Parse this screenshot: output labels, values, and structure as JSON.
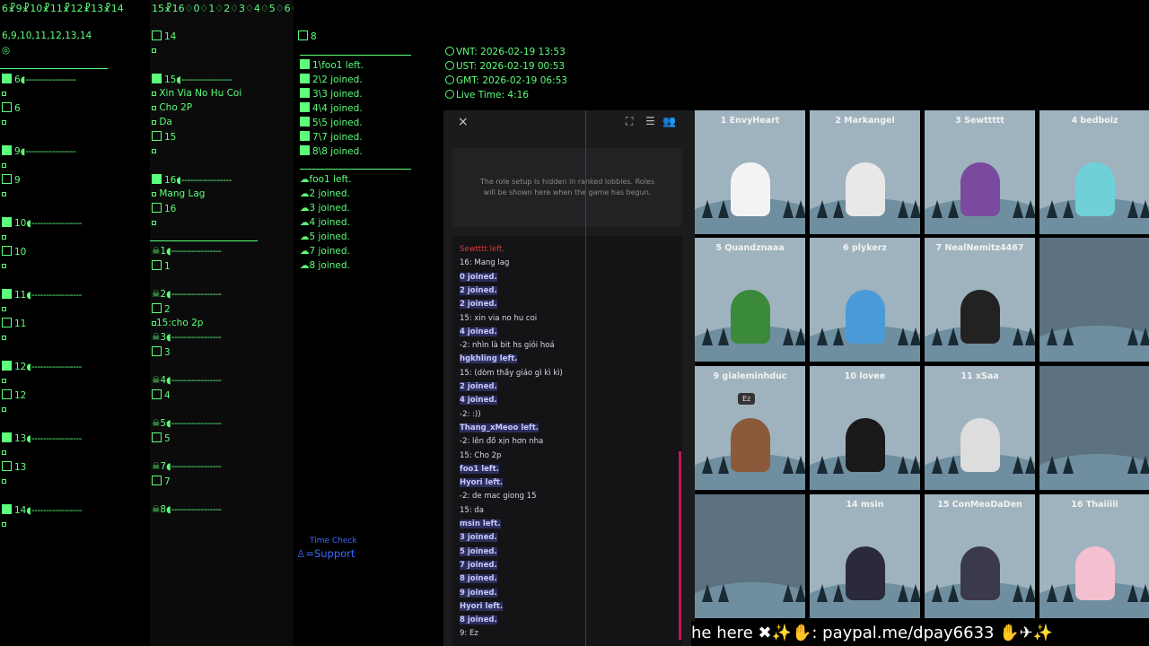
{
  "col1": {
    "header": "6☧9☧10☧11☧12☧13☧14",
    "sub": "6,9,10,11,12,13,14",
    "groups": [
      {
        "num": "6",
        "label": "6"
      },
      {
        "num": "9",
        "label": "9"
      },
      {
        "num": "10",
        "label": "10"
      },
      {
        "num": "11",
        "label": "11"
      },
      {
        "num": "12",
        "label": "12"
      },
      {
        "num": "13",
        "label": "13"
      },
      {
        "num": "14",
        "label": ""
      }
    ]
  },
  "col2": {
    "header": "15☧16♢0♢1♢2♢3♢4♢5♢6♢7",
    "top": "14",
    "g15": {
      "num": "15",
      "lines": [
        "Xin Via No Hu Coi",
        "Cho 2P",
        "Da"
      ],
      "label": "15"
    },
    "g16": {
      "num": "16",
      "lines": [
        "Mang Lag"
      ],
      "label": "16"
    },
    "dead": [
      {
        "num": "1",
        "label": "1",
        "extra": ""
      },
      {
        "num": "2",
        "label": "2",
        "extra": "15:cho 2p"
      },
      {
        "num": "3",
        "label": "3",
        "extra": ""
      },
      {
        "num": "4",
        "label": "4",
        "extra": ""
      },
      {
        "num": "5",
        "label": "5",
        "extra": ""
      },
      {
        "num": "7",
        "label": "7",
        "extra": ""
      },
      {
        "num": "8",
        "label": "",
        "extra": ""
      }
    ]
  },
  "col3": {
    "top": "8",
    "log1": [
      "1\\foo1 left.",
      "2\\2 joined.",
      "3\\3 joined.",
      "4\\4 joined.",
      "5\\5 joined.",
      "7\\7 joined.",
      "8\\8 joined."
    ],
    "log2": [
      "foo1 left.",
      "2 joined.",
      "3 joined.",
      "4 joined.",
      "5 joined.",
      "7 joined.",
      "8 joined."
    ],
    "support": "=Support",
    "support_hidden": "Time Check"
  },
  "clock": [
    "VNT: 2026-02-19 13:53",
    "UST: 2026-02-19 00:53",
    "GMT: 2026-02-19 06:53",
    "Live Time: 4:16"
  ],
  "panel": {
    "close": "×",
    "roles_text": "The role setup is hidden in ranked lobbies. Roles will be shown here when the game has begun.",
    "chat": [
      {
        "t": "Sewtttt left.",
        "k": "red"
      },
      {
        "t": "16: Mang lag",
        "k": "n"
      },
      {
        "t": "0 joined.",
        "k": "b"
      },
      {
        "t": "2 joined.",
        "k": "b"
      },
      {
        "t": "2 joined.",
        "k": "b"
      },
      {
        "t": "15: xin via no hu coi",
        "k": "n"
      },
      {
        "t": "4 joined.",
        "k": "b"
      },
      {
        "t": "-2: nhìn là bit hs giỏi hoá",
        "k": "n"
      },
      {
        "t": "hgkhling left.",
        "k": "b"
      },
      {
        "t": "15: (dòm thầy giáo gì kì kì)",
        "k": "n"
      },
      {
        "t": "2 joined.",
        "k": "b"
      },
      {
        "t": "4 joined.",
        "k": "b"
      },
      {
        "t": "-2: :))",
        "k": "n"
      },
      {
        "t": "Thang_xMeoo left.",
        "k": "b"
      },
      {
        "t": "-2: lên đồ xịn hơn nha",
        "k": "n"
      },
      {
        "t": "15: Cho 2p",
        "k": "n"
      },
      {
        "t": "foo1 left.",
        "k": "b"
      },
      {
        "t": "Hyori left.",
        "k": "b"
      },
      {
        "t": "-2: de mac giong 15",
        "k": "n"
      },
      {
        "t": "15: da",
        "k": "n"
      },
      {
        "t": "msin left.",
        "k": "b"
      },
      {
        "t": "3 joined.",
        "k": "b"
      },
      {
        "t": "5 joined.",
        "k": "b"
      },
      {
        "t": "7 joined.",
        "k": "b"
      },
      {
        "t": "8 joined.",
        "k": "b"
      },
      {
        "t": "9 joined.",
        "k": "b"
      },
      {
        "t": "Hyori left.",
        "k": "b"
      },
      {
        "t": "8 joined.",
        "k": "b"
      },
      {
        "t": "9: Ez",
        "k": "n"
      }
    ]
  },
  "players": [
    {
      "name": "1 EnvyHeart",
      "color": "#f3f3f3"
    },
    {
      "name": "2 Markangel",
      "color": "#e8e8e8"
    },
    {
      "name": "3 Sewttttt",
      "color": "#7a4a9e"
    },
    {
      "name": "4 bedboiz",
      "color": "#6fd0d8"
    },
    {
      "name": "5 Quandznaaa",
      "color": "#3a8a3a"
    },
    {
      "name": "6 plykerz",
      "color": "#4a9ad8"
    },
    {
      "name": "7 NealNemitz4467",
      "color": "#222222"
    },
    {
      "name": "",
      "color": ""
    },
    {
      "name": "9 gialeminhduc",
      "color": "#8a5a3a"
    },
    {
      "name": "10 lovee",
      "color": "#1a1a1a"
    },
    {
      "name": "11 xSaa",
      "color": "#dddddd"
    },
    {
      "name": "",
      "color": ""
    },
    {
      "name": "",
      "color": ""
    },
    {
      "name": "14 msin",
      "color": "#2a2a3a"
    },
    {
      "name": "15 ConMeoDaDen",
      "color": "#3a3a4a"
    },
    {
      "name": "16 Thaiiiii",
      "color": "#f4c0d0"
    }
  ],
  "bubble": "Ez",
  "ticker": "he here ✖✨✋: paypal.me/dpay6633 ✋✈✨"
}
